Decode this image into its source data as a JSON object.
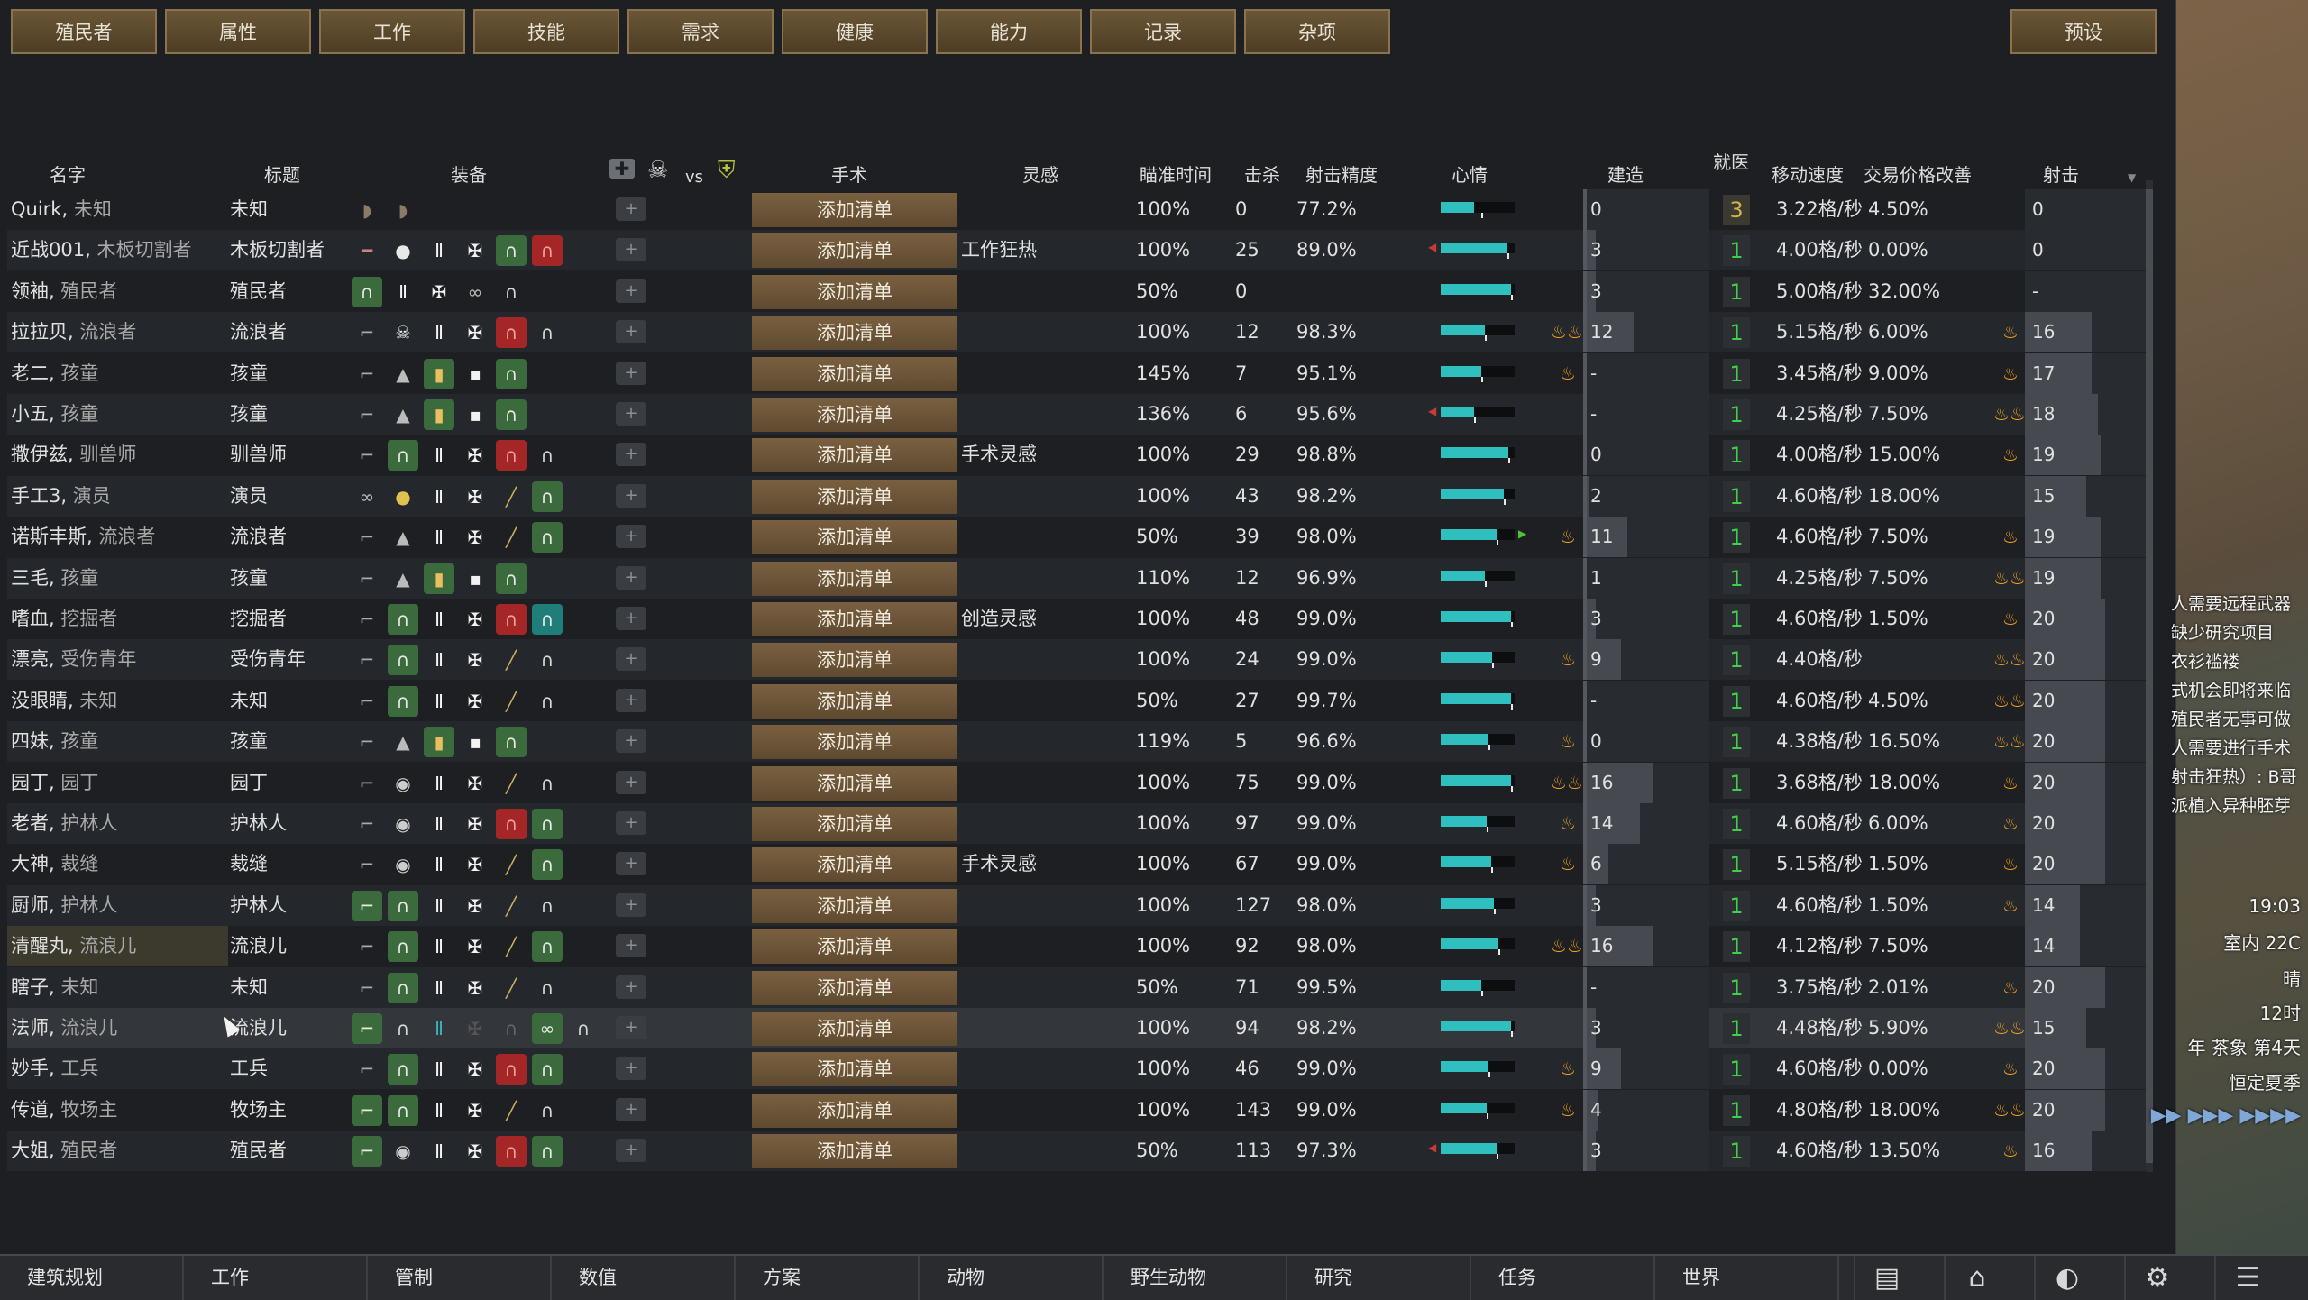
{
  "tabs": [
    "殖民者",
    "属性",
    "工作",
    "技能",
    "需求",
    "健康",
    "能力",
    "记录",
    "杂项"
  ],
  "preset_label": "预设",
  "columns": {
    "name": "名字",
    "title": "标题",
    "equipment": "装备",
    "vs": "vs",
    "surgery": "手术",
    "inspiration": "灵感",
    "aim_time": "瞄准时间",
    "kills": "击杀",
    "accuracy": "射击精度",
    "mood": "心情",
    "construction": "建造",
    "doctor": "就医",
    "move_speed": "移动速度",
    "trade": "交易价格改善",
    "shooting": "射击"
  },
  "surgery_button": "添加清单",
  "rows": [
    {
      "name": "Quirk",
      "sub": "未知",
      "title": "未知",
      "equip": [
        "shield-icon-gray",
        "shield-icon-gray"
      ],
      "insp": "",
      "aim": "100%",
      "kills": "0",
      "acc": "77.2%",
      "mood": 0.45,
      "mood_mark": 0.55,
      "mood_low": false,
      "flame": 0,
      "build": "0",
      "build_lvl": 0,
      "prio": "3",
      "speed": "3.22格/秒",
      "trade": "4.50%",
      "shoot": "0",
      "shoot_lvl": 0,
      "sflame": 0
    },
    {
      "name": "近战001",
      "sub": "木板切割者",
      "title": "木板切割者",
      "equip": [
        "knife-icon",
        "gloves-icon",
        "vest-icon",
        "chest-icon",
        "helmet-icon-green",
        "helmet-icon-red"
      ],
      "insp": "工作狂热",
      "aim": "100%",
      "kills": "25",
      "acc": "89.0%",
      "mood": 0.9,
      "mood_mark": 0.9,
      "mood_low": true,
      "flame": 0,
      "build": "3",
      "build_lvl": 0.1,
      "prio": "1",
      "speed": "4.00格/秒",
      "trade": "0.00%",
      "shoot": "0",
      "shoot_lvl": 0,
      "sflame": 0
    },
    {
      "name": "领袖",
      "sub": "殖民者",
      "title": "殖民者",
      "equip": [
        "helmet-icon-green",
        "vest-icon",
        "chest-icon",
        "goggles-icon",
        "helmet-icon"
      ],
      "insp": "",
      "aim": "50%",
      "kills": "0",
      "acc": "",
      "mood": 0.95,
      "mood_mark": 0.95,
      "mood_low": false,
      "flame": 0,
      "build": "3",
      "build_lvl": 0.1,
      "prio": "1",
      "speed": "5.00格/秒",
      "trade": "32.00%",
      "shoot": "-",
      "shoot_lvl": 0,
      "sflame": 0
    },
    {
      "name": "拉拉贝",
      "sub": "流浪者",
      "title": "流浪者",
      "equip": [
        "rifle-icon",
        "skull-icon",
        "vest-icon",
        "chest-icon",
        "helmet-icon-red",
        "helmet-icon"
      ],
      "insp": "",
      "aim": "100%",
      "kills": "12",
      "acc": "98.3%",
      "mood": 0.6,
      "mood_mark": 0.6,
      "mood_low": false,
      "flame": 2,
      "build": "12",
      "build_lvl": 0.4,
      "prio": "1",
      "speed": "5.15格/秒",
      "trade": "6.00%",
      "shoot": "16",
      "shoot_lvl": 0.55,
      "sflame": 1
    },
    {
      "name": "老二",
      "sub": "孩童",
      "title": "孩童",
      "equip": [
        "rifle-icon",
        "hat-icon",
        "vest-icon-green",
        "chest-icon-small",
        "helmet-icon-green"
      ],
      "insp": "",
      "aim": "145%",
      "kills": "7",
      "acc": "95.1%",
      "mood": 0.55,
      "mood_mark": 0.55,
      "mood_low": false,
      "flame": 1,
      "build": "-",
      "build_lvl": 0,
      "prio": "1",
      "speed": "3.45格/秒",
      "trade": "9.00%",
      "shoot": "17",
      "shoot_lvl": 0.55,
      "sflame": 1
    },
    {
      "name": "小五",
      "sub": "孩童",
      "title": "孩童",
      "equip": [
        "rifle-icon",
        "hat-icon",
        "vest-icon-green",
        "chest-icon-small",
        "helmet-icon-green"
      ],
      "insp": "",
      "aim": "136%",
      "kills": "6",
      "acc": "95.6%",
      "mood": 0.45,
      "mood_mark": 0.45,
      "mood_low": true,
      "flame": 0,
      "build": "-",
      "build_lvl": 0,
      "prio": "1",
      "speed": "4.25格/秒",
      "trade": "7.50%",
      "shoot": "18",
      "shoot_lvl": 0.6,
      "sflame": 2
    },
    {
      "name": "撒伊兹",
      "sub": "驯兽师",
      "title": "驯兽师",
      "equip": [
        "rifle-icon",
        "helmet-icon-green",
        "vest-icon",
        "chest-icon",
        "helmet-icon-red",
        "helmet-icon"
      ],
      "insp": "手术灵感",
      "aim": "100%",
      "kills": "29",
      "acc": "98.8%",
      "mood": 0.92,
      "mood_mark": 0.92,
      "mood_low": false,
      "flame": 0,
      "build": "0",
      "build_lvl": 0,
      "prio": "1",
      "speed": "4.00格/秒",
      "trade": "15.00%",
      "shoot": "19",
      "shoot_lvl": 0.62,
      "sflame": 1
    },
    {
      "name": "手工3",
      "sub": "演员",
      "title": "演员",
      "equip": [
        "goggles-icon",
        "bag-icon",
        "vest-icon",
        "chest-icon",
        "spear-icon",
        "helmet-icon-green"
      ],
      "insp": "",
      "aim": "100%",
      "kills": "43",
      "acc": "98.2%",
      "mood": 0.85,
      "mood_mark": 0.85,
      "mood_low": false,
      "flame": 0,
      "build": "2",
      "build_lvl": 0.05,
      "prio": "1",
      "speed": "4.60格/秒",
      "trade": "18.00%",
      "shoot": "15",
      "shoot_lvl": 0.5,
      "sflame": 0
    },
    {
      "name": "诺斯丰斯",
      "sub": "流浪者",
      "title": "流浪者",
      "equip": [
        "rifle-icon",
        "hat-icon",
        "vest-icon",
        "chest-icon",
        "spear-icon",
        "helmet-icon-green"
      ],
      "insp": "",
      "aim": "50%",
      "kills": "39",
      "acc": "98.0%",
      "mood": 0.75,
      "mood_mark": 0.75,
      "mood_low": false,
      "mood_up": true,
      "flame": 1,
      "build": "11",
      "build_lvl": 0.35,
      "prio": "1",
      "speed": "4.60格/秒",
      "trade": "7.50%",
      "shoot": "19",
      "shoot_lvl": 0.62,
      "sflame": 1
    },
    {
      "name": "三毛",
      "sub": "孩童",
      "title": "孩童",
      "equip": [
        "rifle-icon",
        "hat-icon",
        "vest-icon-green",
        "chest-icon-small",
        "helmet-icon-green"
      ],
      "insp": "",
      "aim": "110%",
      "kills": "12",
      "acc": "96.9%",
      "mood": 0.6,
      "mood_mark": 0.6,
      "mood_low": false,
      "flame": 0,
      "build": "1",
      "build_lvl": 0.03,
      "prio": "1",
      "speed": "4.25格/秒",
      "trade": "7.50%",
      "shoot": "19",
      "shoot_lvl": 0.62,
      "sflame": 2
    },
    {
      "name": "嗜血",
      "sub": "挖掘者",
      "title": "挖掘者",
      "equip": [
        "rifle-icon",
        "helmet-icon-green",
        "vest-icon",
        "chest-icon",
        "helmet-icon-red",
        "helmet-icon-teal"
      ],
      "insp": "创造灵感",
      "aim": "100%",
      "kills": "48",
      "acc": "99.0%",
      "mood": 0.95,
      "mood_mark": 0.95,
      "mood_low": false,
      "flame": 0,
      "build": "3",
      "build_lvl": 0.1,
      "prio": "1",
      "speed": "4.60格/秒",
      "trade": "1.50%",
      "shoot": "20",
      "shoot_lvl": 0.66,
      "sflame": 1
    },
    {
      "name": "漂亮",
      "sub": "受伤青年",
      "title": "受伤青年",
      "equip": [
        "rifle-icon",
        "helmet-icon-green",
        "vest-icon",
        "chest-icon",
        "spear-icon",
        "helmet-icon"
      ],
      "insp": "",
      "aim": "100%",
      "kills": "24",
      "acc": "99.0%",
      "mood": 0.7,
      "mood_mark": 0.7,
      "mood_low": false,
      "flame": 1,
      "build": "9",
      "build_lvl": 0.3,
      "prio": "1",
      "speed": "4.40格/秒",
      "trade": "",
      "shoot": "20",
      "shoot_lvl": 0.66,
      "sflame": 2
    },
    {
      "name": "没眼睛",
      "sub": "未知",
      "title": "未知",
      "equip": [
        "rifle-icon",
        "helmet-icon-green",
        "vest-icon",
        "chest-icon",
        "spear-icon",
        "helmet-icon"
      ],
      "insp": "",
      "aim": "50%",
      "kills": "27",
      "acc": "99.7%",
      "mood": 0.95,
      "mood_mark": 0.95,
      "mood_low": false,
      "flame": 0,
      "build": "-",
      "build_lvl": 0,
      "prio": "1",
      "speed": "4.60格/秒",
      "trade": "4.50%",
      "shoot": "20",
      "shoot_lvl": 0.66,
      "sflame": 2
    },
    {
      "name": "四妹",
      "sub": "孩童",
      "title": "孩童",
      "equip": [
        "rifle-icon",
        "hat-icon",
        "vest-icon-green",
        "chest-icon-small",
        "helmet-icon-green"
      ],
      "insp": "",
      "aim": "119%",
      "kills": "5",
      "acc": "96.6%",
      "mood": 0.65,
      "mood_mark": 0.65,
      "mood_low": false,
      "flame": 1,
      "build": "0",
      "build_lvl": 0,
      "prio": "1",
      "speed": "4.38格/秒",
      "trade": "16.50%",
      "shoot": "20",
      "shoot_lvl": 0.66,
      "sflame": 2
    },
    {
      "name": "园丁",
      "sub": "园丁",
      "title": "园丁",
      "equip": [
        "rifle-icon",
        "hat-icon-round",
        "vest-icon",
        "chest-icon",
        "spear-icon",
        "helmet-icon"
      ],
      "insp": "",
      "aim": "100%",
      "kills": "75",
      "acc": "99.0%",
      "mood": 0.95,
      "mood_mark": 0.95,
      "mood_low": false,
      "flame": 2,
      "build": "16",
      "build_lvl": 0.55,
      "prio": "1",
      "speed": "3.68格/秒",
      "trade": "18.00%",
      "shoot": "20",
      "shoot_lvl": 0.66,
      "sflame": 1
    },
    {
      "name": "老者",
      "sub": "护林人",
      "title": "护林人",
      "equip": [
        "rifle-icon",
        "hat-icon-round",
        "vest-icon",
        "chest-icon",
        "helmet-icon-red",
        "helmet-icon-green"
      ],
      "insp": "",
      "aim": "100%",
      "kills": "97",
      "acc": "99.0%",
      "mood": 0.62,
      "mood_mark": 0.62,
      "mood_low": false,
      "flame": 1,
      "build": "14",
      "build_lvl": 0.45,
      "prio": "1",
      "speed": "4.60格/秒",
      "trade": "6.00%",
      "shoot": "20",
      "shoot_lvl": 0.66,
      "sflame": 1
    },
    {
      "name": "大神",
      "sub": "裁缝",
      "title": "裁缝",
      "equip": [
        "rifle-icon",
        "hat-icon-round",
        "vest-icon",
        "chest-icon",
        "spear-icon",
        "helmet-icon-green"
      ],
      "insp": "手术灵感",
      "aim": "100%",
      "kills": "67",
      "acc": "99.0%",
      "mood": 0.68,
      "mood_mark": 0.68,
      "mood_low": false,
      "flame": 1,
      "build": "6",
      "build_lvl": 0.2,
      "prio": "1",
      "speed": "5.15格/秒",
      "trade": "1.50%",
      "shoot": "20",
      "shoot_lvl": 0.66,
      "sflame": 1
    },
    {
      "name": "厨师",
      "sub": "护林人",
      "title": "护林人",
      "equip": [
        "rifle-icon-green",
        "helmet-icon-green",
        "vest-icon",
        "chest-icon",
        "spear-icon",
        "helmet-icon"
      ],
      "insp": "",
      "aim": "100%",
      "kills": "127",
      "acc": "98.0%",
      "mood": 0.72,
      "mood_mark": 0.72,
      "mood_low": false,
      "flame": 0,
      "build": "3",
      "build_lvl": 0.1,
      "prio": "1",
      "speed": "4.60格/秒",
      "trade": "1.50%",
      "shoot": "14",
      "shoot_lvl": 0.45,
      "sflame": 1
    },
    {
      "name": "清醒丸",
      "sub": "流浪儿",
      "title": "流浪儿",
      "equip": [
        "rifle-icon",
        "helmet-icon-green",
        "vest-icon",
        "chest-icon",
        "spear-icon",
        "helmet-icon-green"
      ],
      "insp": "",
      "aim": "100%",
      "kills": "92",
      "acc": "98.0%",
      "mood": 0.78,
      "mood_mark": 0.78,
      "mood_low": false,
      "flame": 2,
      "build": "16",
      "build_lvl": 0.55,
      "prio": "1",
      "speed": "4.12格/秒",
      "trade": "7.50%",
      "shoot": "14",
      "shoot_lvl": 0.45,
      "sflame": 0
    },
    {
      "name": "瞎子",
      "sub": "未知",
      "title": "未知",
      "equip": [
        "rifle-icon",
        "helmet-icon-green",
        "vest-icon",
        "chest-icon",
        "spear-icon",
        "helmet-icon"
      ],
      "insp": "",
      "aim": "50%",
      "kills": "71",
      "acc": "99.5%",
      "mood": 0.55,
      "mood_mark": 0.55,
      "mood_low": false,
      "flame": 0,
      "build": "-",
      "build_lvl": 0,
      "prio": "1",
      "speed": "3.75格/秒",
      "trade": "2.01%",
      "shoot": "20",
      "shoot_lvl": 0.66,
      "sflame": 1
    },
    {
      "name": "法师",
      "sub": "流浪儿",
      "title": "流浪儿",
      "equip": [
        "rifle-icon-green",
        "helmet-icon",
        "vest-icon-teal",
        "chest-icon-dark",
        "helmet-icon-dark",
        "goggles-icon-green",
        "helmet-icon"
      ],
      "insp": "",
      "aim": "100%",
      "kills": "94",
      "acc": "98.2%",
      "mood": 0.95,
      "mood_mark": 0.95,
      "mood_low": false,
      "flame": 0,
      "build": "3",
      "build_lvl": 0.1,
      "prio": "1",
      "speed": "4.48格/秒",
      "trade": "5.90%",
      "shoot": "15",
      "shoot_lvl": 0.5,
      "sflame": 2
    },
    {
      "name": "妙手",
      "sub": "工兵",
      "title": "工兵",
      "equip": [
        "rifle-icon",
        "helmet-icon-green",
        "vest-icon",
        "chest-icon",
        "helmet-icon-red",
        "helmet-icon-green"
      ],
      "insp": "",
      "aim": "100%",
      "kills": "46",
      "acc": "99.0%",
      "mood": 0.65,
      "mood_mark": 0.65,
      "mood_low": false,
      "flame": 1,
      "build": "9",
      "build_lvl": 0.3,
      "prio": "1",
      "speed": "4.60格/秒",
      "trade": "0.00%",
      "shoot": "20",
      "shoot_lvl": 0.66,
      "sflame": 1
    },
    {
      "name": "传道",
      "sub": "牧场主",
      "title": "牧场主",
      "equip": [
        "rifle-icon-green",
        "helmet-icon-green",
        "vest-icon",
        "chest-icon",
        "spear-icon",
        "helmet-icon"
      ],
      "insp": "",
      "aim": "100%",
      "kills": "143",
      "acc": "99.0%",
      "mood": 0.62,
      "mood_mark": 0.62,
      "mood_low": false,
      "flame": 1,
      "build": "4",
      "build_lvl": 0.12,
      "prio": "1",
      "speed": "4.80格/秒",
      "trade": "18.00%",
      "shoot": "20",
      "shoot_lvl": 0.66,
      "sflame": 2
    },
    {
      "name": "大姐",
      "sub": "殖民者",
      "title": "殖民者",
      "equip": [
        "rifle-icon-green",
        "hat-icon-round",
        "vest-icon",
        "chest-icon",
        "helmet-icon-red",
        "helmet-icon-green"
      ],
      "insp": "",
      "aim": "50%",
      "kills": "113",
      "acc": "97.3%",
      "mood": 0.75,
      "mood_mark": 0.75,
      "mood_low": true,
      "flame": 0,
      "build": "3",
      "build_lvl": 0.1,
      "prio": "1",
      "speed": "4.60格/秒",
      "trade": "13.50%",
      "shoot": "16",
      "shoot_lvl": 0.55,
      "sflame": 1
    }
  ],
  "bottom_tabs": [
    "建筑规划",
    "工作",
    "管制",
    "数值",
    "方案",
    "动物",
    "野生动物",
    "研究",
    "任务",
    "世界"
  ],
  "bottom_icons": [
    "book-icon",
    "museum-icon",
    "lightbulb-icon",
    "gear-list-icon",
    "menu-icon"
  ],
  "alerts": [
    "人需要远程武器",
    "缺少研究项目",
    "衣衫褴褛",
    "式机会即将来临",
    "殖民者无事可做",
    "人需要进行手术",
    "射击狂热）: B哥",
    "派植入异种胚芽"
  ],
  "time_info": {
    "time": "19:03",
    "temp": "室内 22C",
    "weather": "晴",
    "hour": "12时",
    "date": "年 茶象 第4天",
    "season": "恒定夏季"
  },
  "colors": {
    "tab_bg": "#5a4a30",
    "surgery_bg": "#6e563a",
    "mood": "#2fbfbf",
    "prio_green": "#3ed24a",
    "flame": "#f4a21e"
  }
}
